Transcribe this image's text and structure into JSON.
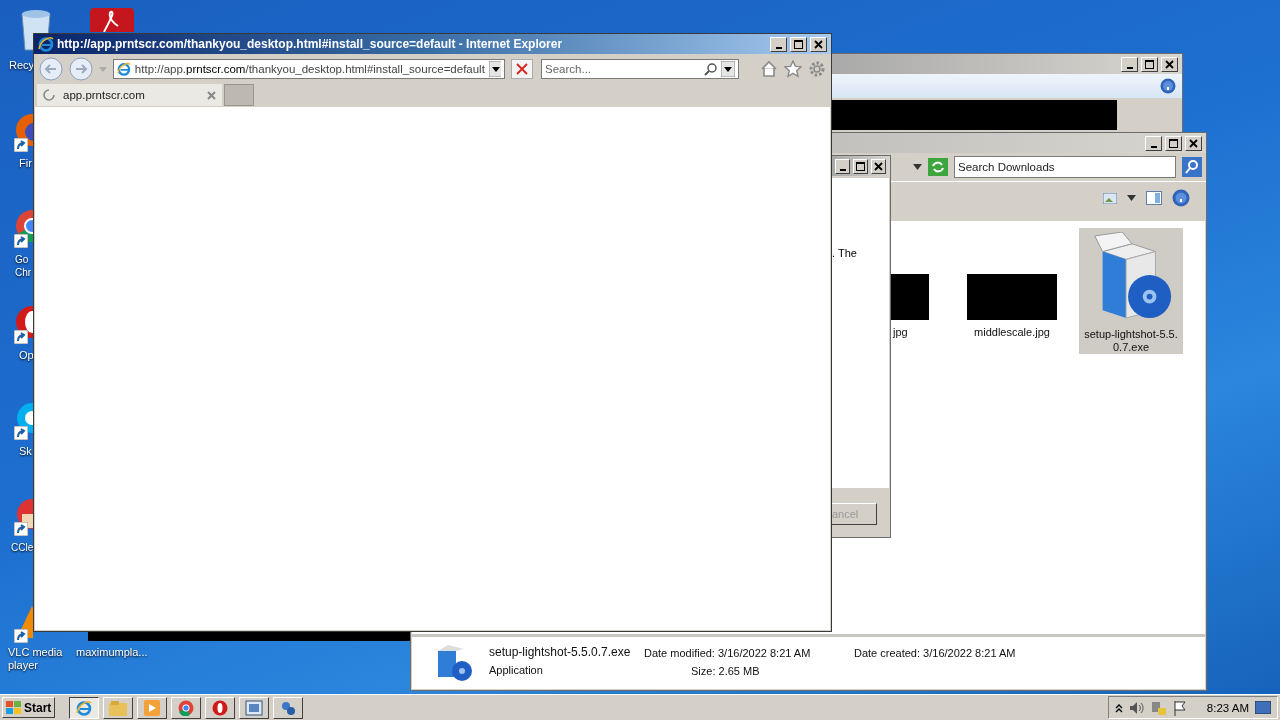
{
  "desktop_icons": [
    {
      "kind": "bin",
      "lines": [
        "Recy"
      ]
    },
    {
      "kind": "pdf"
    },
    {
      "kind": "firefox",
      "lines": [
        "Fir"
      ]
    },
    {
      "kind": "chrome",
      "lines": [
        "Go",
        "Chr"
      ]
    },
    {
      "kind": "opera",
      "lines": [
        "Op"
      ]
    },
    {
      "kind": "skype",
      "lines": [
        "Sk"
      ]
    },
    {
      "kind": "ccleaner",
      "lines": [
        "CCle"
      ]
    },
    {
      "kind": "vlc",
      "lines": [
        "VLC media",
        "player"
      ]
    },
    {
      "kind": "file",
      "lines": [
        "maximumpla..."
      ]
    }
  ],
  "back_window": {
    "kind": "dialog"
  },
  "explorer": {
    "search": {
      "placeholder": "Search Downloads"
    },
    "files": [
      {
        "kind": "image",
        "name": "jpg",
        "selected": false
      },
      {
        "kind": "image",
        "name": "middlescale.jpg",
        "selected": false
      },
      {
        "kind": "installer",
        "name": "setup-lightshot-5.5.0.7.exe",
        "selected": true
      }
    ],
    "details": {
      "name": "setup-lightshot-5.5.0.7.exe",
      "type": "Application",
      "modified": "Date modified: 3/16/2022 8:21 AM",
      "size": "Size: 2.65 MB",
      "created": "Date created: 3/16/2022 8:21 AM"
    }
  },
  "installer_dialog": {
    "text": ". The",
    "button": "ancel"
  },
  "ie_window": {
    "title": "http://app.prntscr.com/thankyou_desktop.html#install_source=default - Internet Explorer",
    "address": {
      "prefix": "http://app.",
      "domain": "prntscr.com",
      "path": "/thankyou_desktop.html#install_source=default"
    },
    "search": {
      "placeholder": "Search..."
    },
    "tabs": [
      {
        "label": "app.prntscr.com",
        "selected": true
      }
    ]
  },
  "taskbar": {
    "start": "Start",
    "apps": [
      {
        "kind": "ie",
        "selected": true
      },
      {
        "kind": "folder",
        "selected": false
      },
      {
        "kind": "media",
        "selected": false
      },
      {
        "kind": "chrome",
        "selected": false
      },
      {
        "kind": "opera",
        "selected": false
      },
      {
        "kind": "screen",
        "selected": false
      },
      {
        "kind": "tool",
        "selected": false
      }
    ],
    "clock": "8:23 AM"
  }
}
